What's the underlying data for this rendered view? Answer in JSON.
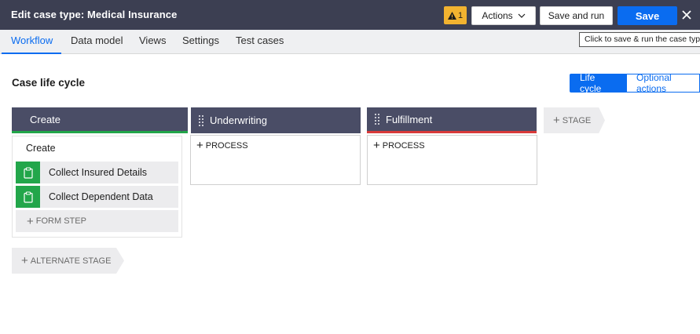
{
  "header": {
    "title_prefix": "Edit case type:",
    "title_name": "Medical Insurance",
    "warning_count": "1",
    "actions_label": "Actions",
    "save_and_run_label": "Save and run",
    "save_label": "Save",
    "bg_color": "#3c3f52",
    "accent_color": "#0a6cf0",
    "warning_color": "#f2b330"
  },
  "tabs": [
    {
      "label": "Workflow",
      "active": true
    },
    {
      "label": "Data model",
      "active": false
    },
    {
      "label": "Views",
      "active": false
    },
    {
      "label": "Settings",
      "active": false
    },
    {
      "label": "Test cases",
      "active": false
    }
  ],
  "tooltip": "Click to save & run the case type",
  "section": {
    "title": "Case life cycle",
    "toggle_on": "Life cycle",
    "toggle_off": "Optional actions"
  },
  "stages": [
    {
      "name": "Create",
      "status_color": "#22a64a",
      "process_name": "Create",
      "steps": [
        {
          "label": "Collect Insured Details",
          "icon": "clipboard-icon"
        },
        {
          "label": "Collect Dependent Data",
          "icon": "clipboard-icon"
        }
      ],
      "add_step_label": "FORM STEP"
    },
    {
      "name": "Underwriting",
      "add_process_label": "PROCESS"
    },
    {
      "name": "Fulfillment",
      "status_color": "#d93a3a",
      "add_process_label": "PROCESS"
    }
  ],
  "add_stage_label": "STAGE",
  "alternate_stage_label": "ALTERNATE STAGE"
}
